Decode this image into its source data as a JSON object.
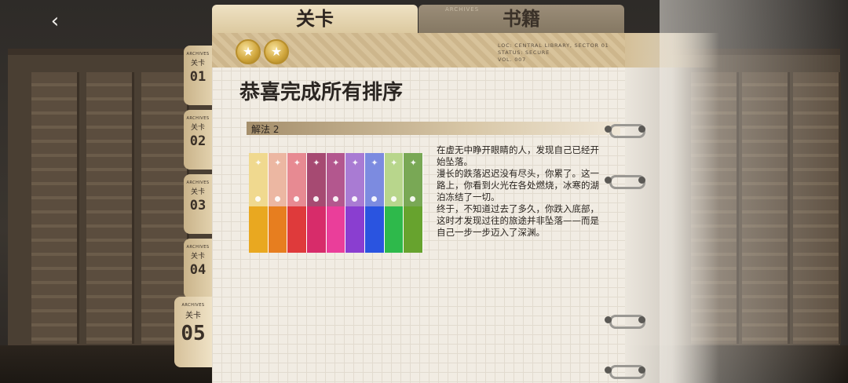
{
  "tabs": {
    "active": "关卡",
    "inactive": "书籍",
    "inactive_sub": "ARCHIVES"
  },
  "location": {
    "loc": "LOC: CENTRAL LIBRARY, SECTOR 01",
    "status": "STATUS: SECURE",
    "vol": "VOL. 007"
  },
  "medals": [
    "★",
    "★"
  ],
  "title": "恭喜完成所有排序",
  "solution_label": "解法 2",
  "story": [
    "在虚无中睁开眼睛的人，发现自己已经开始坠落。",
    "漫长的跌落迟迟没有尽头，你累了。这一路上，你看到火光在各处燃烧，冰寒的湖泊冻结了一切。",
    "终于，不知道过去了多久，你跌入底部，这时才发现过往的旅途并非坠落——而是自己一步一步迈入了深渊。"
  ],
  "side_tabs": [
    {
      "archives": "ARCHIVES",
      "level": "关卡",
      "num": "01"
    },
    {
      "archives": "ARCHIVES",
      "level": "关卡",
      "num": "02"
    },
    {
      "archives": "ARCHIVES",
      "level": "关卡",
      "num": "03"
    },
    {
      "archives": "ARCHIVES",
      "level": "关卡",
      "num": "04"
    },
    {
      "archives": "ARCHIVES",
      "level": "关卡",
      "num": "05"
    }
  ],
  "books": [
    {
      "top": "#f0d98f",
      "bottom": "#e9a820"
    },
    {
      "top": "#ecb7a2",
      "bottom": "#e77e1f"
    },
    {
      "top": "#e78a92",
      "bottom": "#df3a3b"
    },
    {
      "top": "#a64a72",
      "bottom": "#d72c6a"
    },
    {
      "top": "#b3578e",
      "bottom": "#ea3e9a"
    },
    {
      "top": "#a97bd3",
      "bottom": "#8a3ed0"
    },
    {
      "top": "#7c8be0",
      "bottom": "#2a54e0"
    },
    {
      "top": "#b8d68c",
      "bottom": "#2eb94b"
    },
    {
      "top": "#79a855",
      "bottom": "#67a32e"
    }
  ],
  "colors": {
    "accent": "#cfa43a",
    "page": "#f1ece3"
  },
  "icons": {
    "back": "chevron-left-icon",
    "medal": "star-medal-icon",
    "ring": "binder-ring-icon"
  }
}
